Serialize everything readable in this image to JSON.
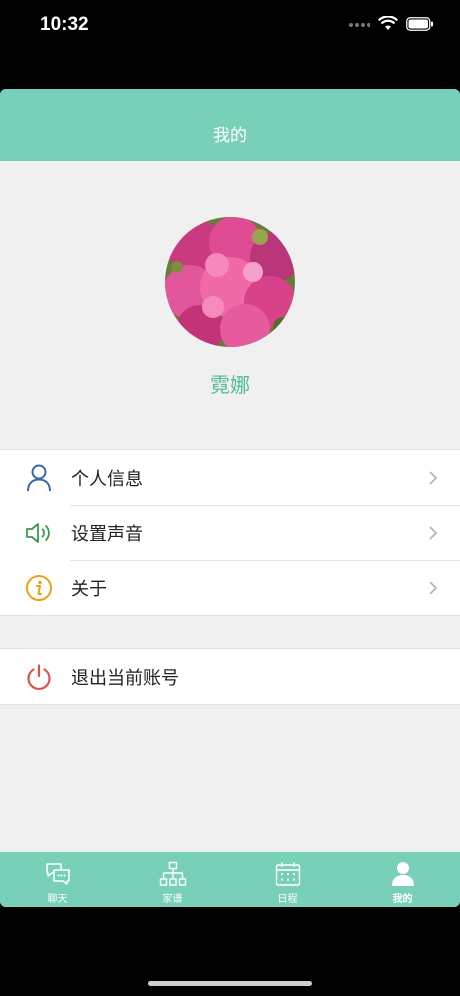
{
  "status": {
    "time": "10:32"
  },
  "nav": {
    "title": "我的"
  },
  "profile": {
    "name": "霓娜"
  },
  "menu": {
    "items": [
      {
        "label": "个人信息",
        "icon": "user-icon"
      },
      {
        "label": "设置声音",
        "icon": "speaker-icon"
      },
      {
        "label": "关于",
        "icon": "info-icon"
      }
    ],
    "logout": {
      "label": "退出当前账号",
      "icon": "power-icon"
    }
  },
  "tabbar": {
    "tabs": [
      {
        "label": "聊天",
        "icon": "chat-icon"
      },
      {
        "label": "家谱",
        "icon": "family-tree-icon"
      },
      {
        "label": "日程",
        "icon": "calendar-icon"
      },
      {
        "label": "我的",
        "icon": "person-icon",
        "active": true
      }
    ]
  },
  "colors": {
    "accent": "#79d0b8",
    "name": "#52b99a",
    "logout": "#d9534f",
    "info": "#e8a317",
    "speaker": "#3a9a4a",
    "user": "#3a66a8"
  }
}
